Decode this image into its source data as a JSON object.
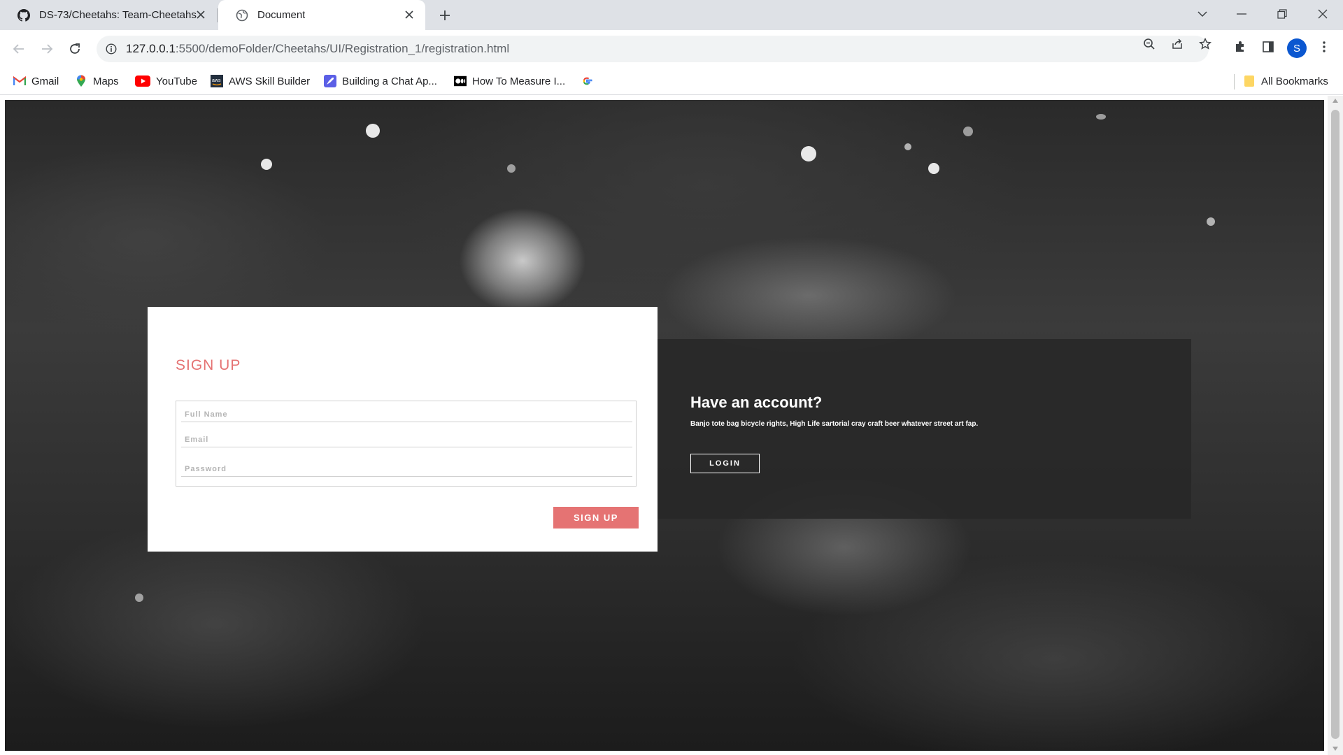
{
  "browser": {
    "tabs": [
      {
        "title": "DS-73/Cheetahs: Team-Cheetahs",
        "icon": "github-icon",
        "active": false
      },
      {
        "title": "Document",
        "icon": "globe-icon",
        "active": true
      }
    ],
    "address_bar": {
      "url_host": "127.0.0.1",
      "url_path": ":5500/demoFolder/Cheetahs/UI/Registration_1/registration.html"
    },
    "profile_initial": "S",
    "bookmarks": [
      {
        "label": "Gmail",
        "icon": "gmail-icon"
      },
      {
        "label": "Maps",
        "icon": "maps-icon"
      },
      {
        "label": "YouTube",
        "icon": "youtube-icon"
      },
      {
        "label": "AWS Skill Builder",
        "icon": "aws-icon"
      },
      {
        "label": "Building a Chat Ap...",
        "icon": "rocket-icon"
      },
      {
        "label": "How To Measure I...",
        "icon": "medium-icon"
      },
      {
        "label": "",
        "icon": "google-icon"
      }
    ],
    "all_bookmarks_label": "All Bookmarks"
  },
  "page": {
    "signup": {
      "title": "SIGN UP",
      "full_name_placeholder": "Full Name",
      "email_placeholder": "Email",
      "password_placeholder": "Password",
      "button_label": "SIGN UP"
    },
    "login": {
      "heading": "Have an account?",
      "text": "Banjo tote bag bicycle rights, High Life sartorial cray craft beer whatever street art fap.",
      "button_label": "LOGIN"
    }
  },
  "colors": {
    "accent": "#e57373",
    "panel_dark": "#282828",
    "tabstrip": "#dee1e6"
  }
}
